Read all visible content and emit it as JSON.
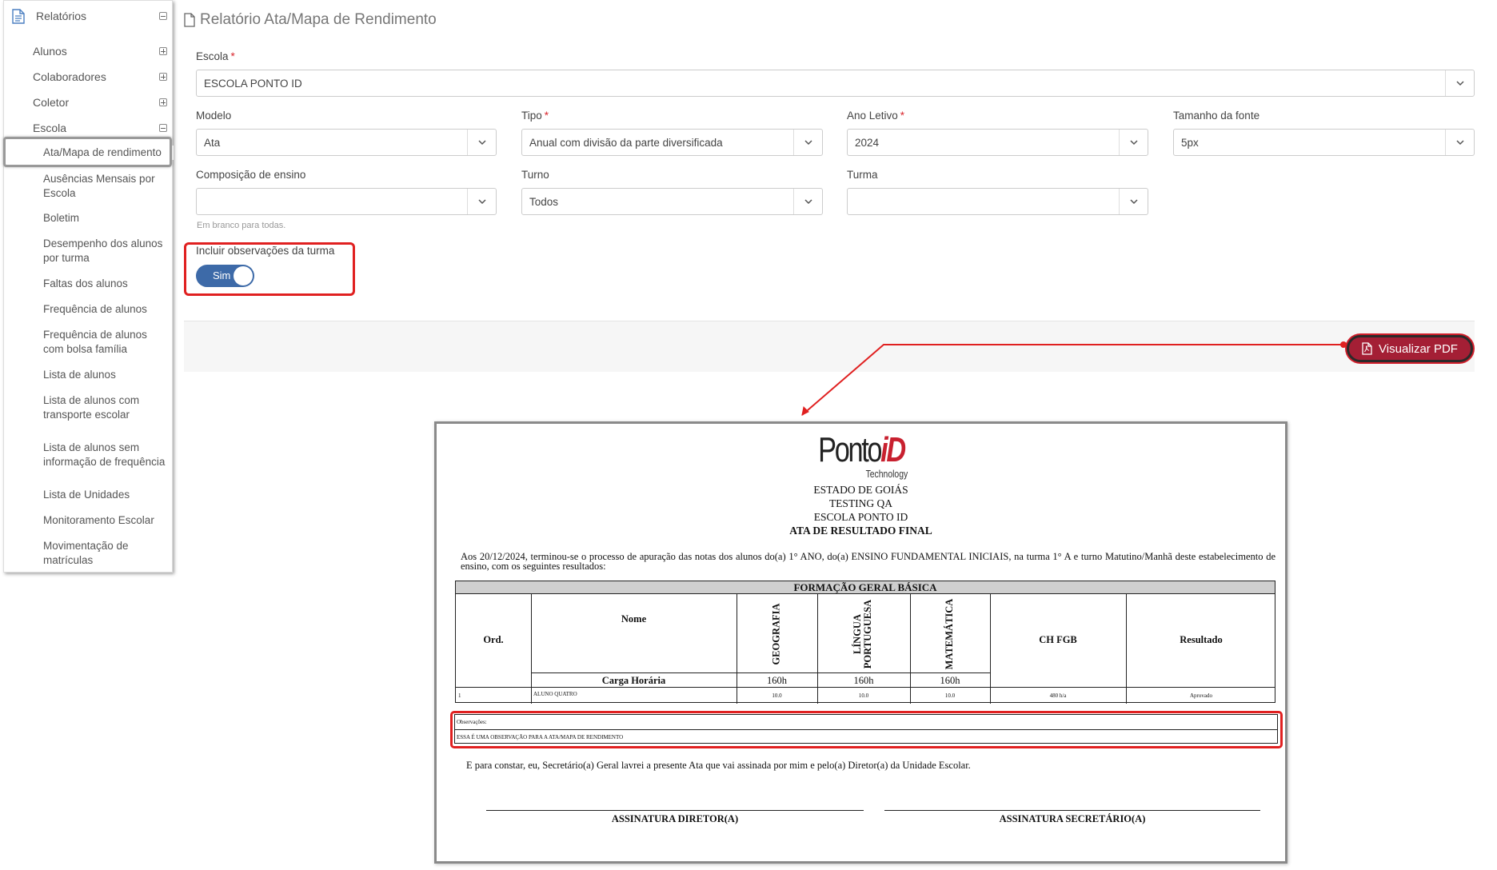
{
  "sidebar": {
    "top": {
      "label": "Relatórios",
      "icon": "document-icon"
    },
    "sections": [
      {
        "label": "Alunos",
        "state": "collapsed"
      },
      {
        "label": "Colaboradores",
        "state": "collapsed"
      },
      {
        "label": "Coletor",
        "state": "collapsed"
      },
      {
        "label": "Escola",
        "state": "expanded"
      }
    ],
    "escola_items": [
      "Ata/Mapa de rendimento",
      "Ausências Mensais por Escola",
      "Boletim",
      "Desempenho dos alunos por turma",
      "Faltas dos alunos",
      "Frequência de alunos",
      "Frequência de alunos com bolsa família",
      "Lista de alunos",
      "Lista de alunos com transporte escolar",
      "Lista de alunos sem informação de frequência",
      "Lista de Unidades",
      "Monitoramento Escolar",
      "Movimentação de matrículas"
    ]
  },
  "page": {
    "title": "Relatório Ata/Mapa de Rendimento"
  },
  "form": {
    "escola": {
      "label": "Escola",
      "required": "*",
      "value": "ESCOLA PONTO ID"
    },
    "modelo": {
      "label": "Modelo",
      "value": "Ata"
    },
    "tipo": {
      "label": "Tipo",
      "required": "*",
      "value": "Anual com divisão da parte diversificada"
    },
    "ano_letivo": {
      "label": "Ano Letivo",
      "required": "*",
      "value": "2024"
    },
    "tamanho_fonte": {
      "label": "Tamanho da fonte",
      "value": "5px"
    },
    "composicao": {
      "label": "Composição de ensino",
      "value": "",
      "help": "Em branco para todas."
    },
    "turno": {
      "label": "Turno",
      "value": "Todos"
    },
    "turma": {
      "label": "Turma",
      "value": ""
    },
    "observacoes": {
      "label": "Incluir observações da turma",
      "toggle_label": "Sim",
      "on": true
    }
  },
  "actions": {
    "visualizar_pdf": "Visualizar PDF"
  },
  "colors": {
    "accent": "#3d6aa8",
    "pdf_button": "#a41f35",
    "highlight": "#e02020"
  },
  "pdf": {
    "logo_text": "Ponto",
    "logo_accent": "iD",
    "logo_sub": "Technology",
    "header": [
      "ESTADO DE GOIÁS",
      "TESTING QA",
      "ESCOLA PONTO ID"
    ],
    "doc_title": "ATA DE RESULTADO FINAL",
    "intro": "Aos 20/12/2024, terminou-se o processo de apuração das notas dos alunos do(a) 1° ANO, do(a) ENSINO FUNDAMENTAL INICIAIS, na turma 1° A e turno Matutino/Manhã deste estabelecimento de ensino, com os seguintes resultados:",
    "table": {
      "section": "FORMAÇÃO GERAL BÁSICA",
      "col_ord": "Ord.",
      "col_nome": "Nome",
      "subjects": [
        "GEOGRAFIA",
        "LÍNGUA PORTUGUESA",
        "MATEMÁTICA"
      ],
      "col_ch": "CH FGB",
      "col_result": "Resultado",
      "carga_label": "Carga Horária",
      "carga_values": [
        "160h",
        "160h",
        "160h"
      ],
      "rows": [
        {
          "ord": "1",
          "nome": "ALUNO QUATRO",
          "notas": [
            "10.0",
            "10.0",
            "10.0"
          ],
          "ch": "480 h/a",
          "resultado": "Aprovado"
        }
      ]
    },
    "obs_label": "Observações:",
    "obs_text": "ESSA É UMA OBSERVAÇÃO PARA A ATA/MAPA DE RENDIMENTO",
    "closing": "E para constar, eu, Secretário(a) Geral lavrei a presente Ata que vai assinada por mim e pelo(a) Diretor(a) da Unidade Escolar.",
    "sig_diretor": "ASSINATURA DIRETOR(A)",
    "sig_secretario": "ASSINATURA SECRETÁRIO(A)"
  }
}
